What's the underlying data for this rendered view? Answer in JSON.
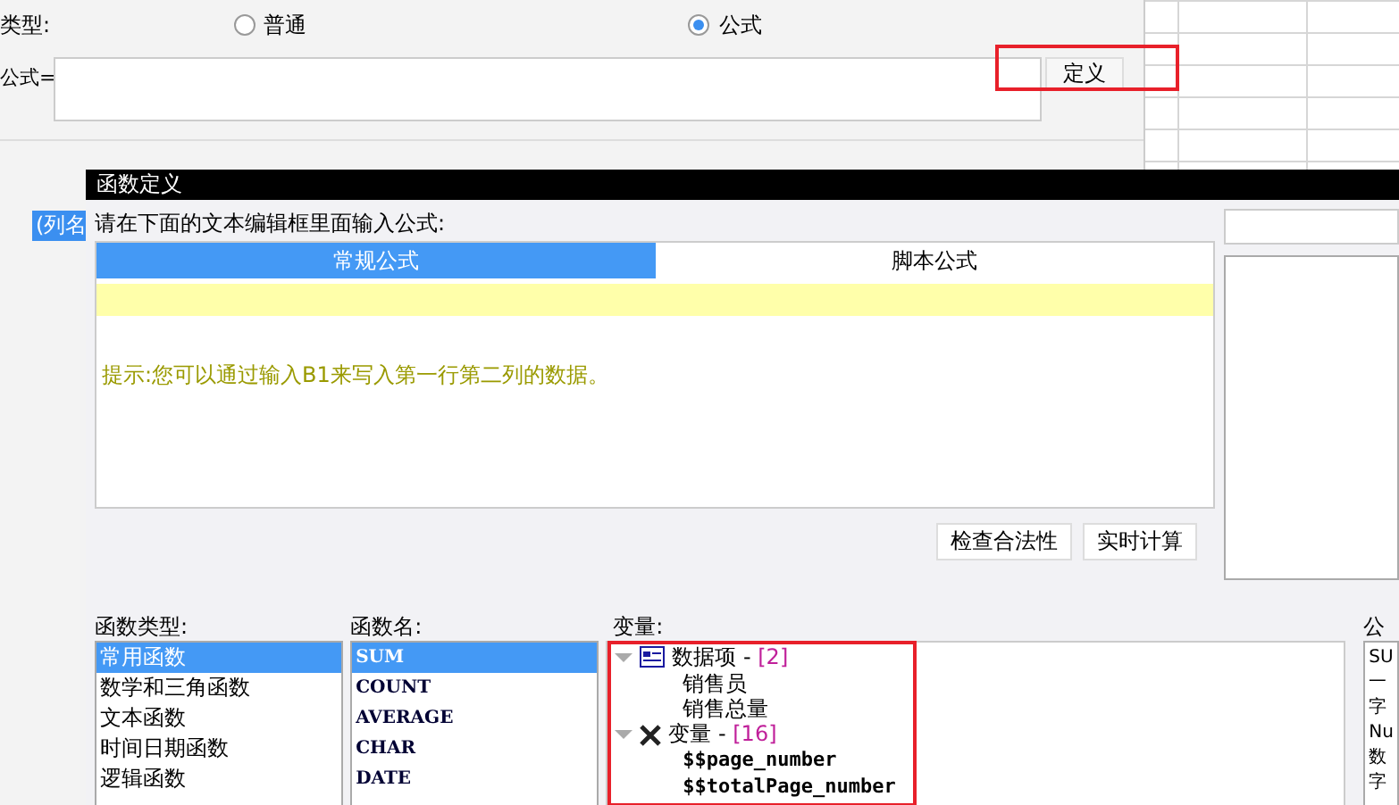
{
  "form": {
    "type_label": "类型:",
    "type_options": [
      {
        "label": "普通",
        "selected": false
      },
      {
        "label": "公式",
        "selected": true
      }
    ],
    "formula_label": "公式=",
    "define_button": "定义",
    "column_tag": "(列名"
  },
  "dialog": {
    "title": "函数定义",
    "instruction": "请在下面的文本编辑框里面输入公式:",
    "tabs": [
      {
        "label": "常规公式",
        "selected": true
      },
      {
        "label": "脚本公式",
        "selected": false
      }
    ],
    "hint": "提示:您可以通过输入B1来写入第一行第二列的数据。",
    "buttons": [
      "检查合法性",
      "实时计算"
    ],
    "function_types": {
      "label": "函数类型:",
      "items": [
        {
          "label": "常用函数",
          "selected": true
        },
        {
          "label": "数学和三角函数",
          "selected": false
        },
        {
          "label": "文本函数",
          "selected": false
        },
        {
          "label": "时间日期函数",
          "selected": false
        },
        {
          "label": "逻辑函数",
          "selected": false
        }
      ]
    },
    "function_names": {
      "label": "函数名:",
      "items": [
        {
          "label": "SUM",
          "selected": true
        },
        {
          "label": "COUNT",
          "selected": false
        },
        {
          "label": "AVERAGE",
          "selected": false
        },
        {
          "label": "CHAR",
          "selected": false
        },
        {
          "label": "DATE",
          "selected": false
        }
      ]
    },
    "variables": {
      "label": "变量:",
      "tree": [
        {
          "kind": "data",
          "label": "数据项 - ",
          "count": "[2]",
          "expanded": true,
          "children": [
            {
              "label": "销售员"
            },
            {
              "label": "销售总量"
            }
          ]
        },
        {
          "kind": "variable",
          "label": "变量 - ",
          "count": "[16]",
          "expanded": true,
          "children": [
            {
              "label": "$$page_number"
            },
            {
              "label": "$$totalPage_number"
            }
          ]
        }
      ]
    },
    "formula_panel": {
      "label": "公",
      "lines": [
        "SU",
        "一",
        "字",
        "Nu",
        "数",
        "字"
      ]
    }
  }
}
